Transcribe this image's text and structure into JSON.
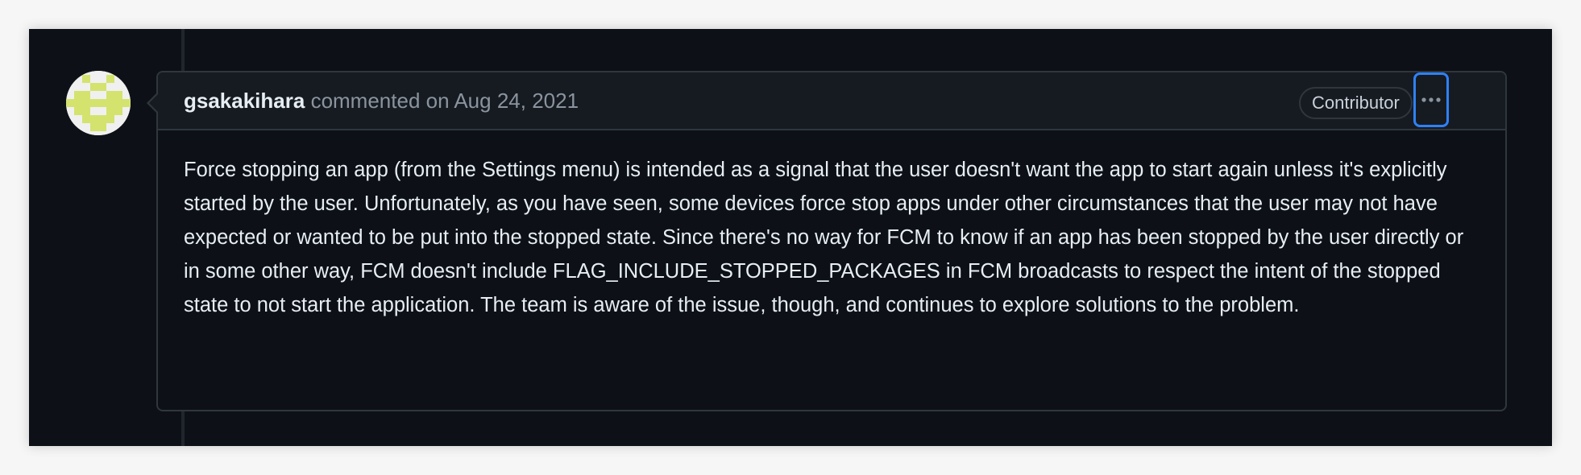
{
  "comment": {
    "author": "gsakakihara",
    "action_text": "commented on",
    "date": "Aug 24, 2021",
    "role_badge": "Contributor",
    "body": "Force stopping an app (from the Settings menu) is intended as a signal that the user doesn't want the app to start again unless it's explicitly started by the user. Unfortunately, as you have seen, some devices force stop apps under other circumstances that the user may not have expected or wanted to be put into the stopped state. Since there's no way for FCM to know if an app has been stopped by the user directly or in some other way, FCM doesn't include FLAG_INCLUDE_STOPPED_PACKAGES in FCM broadcasts to respect the intent of the stopped state to not start the application. The team is aware of the issue, though, and continues to explore solutions to the problem.",
    "more_actions_icon": "kebab-horizontal-icon"
  },
  "colors": {
    "background": "#0d1117",
    "header_background": "#161b22",
    "border": "#30363d",
    "focus_ring": "#2f81f7",
    "avatar_identicon": "#d4e36e"
  }
}
